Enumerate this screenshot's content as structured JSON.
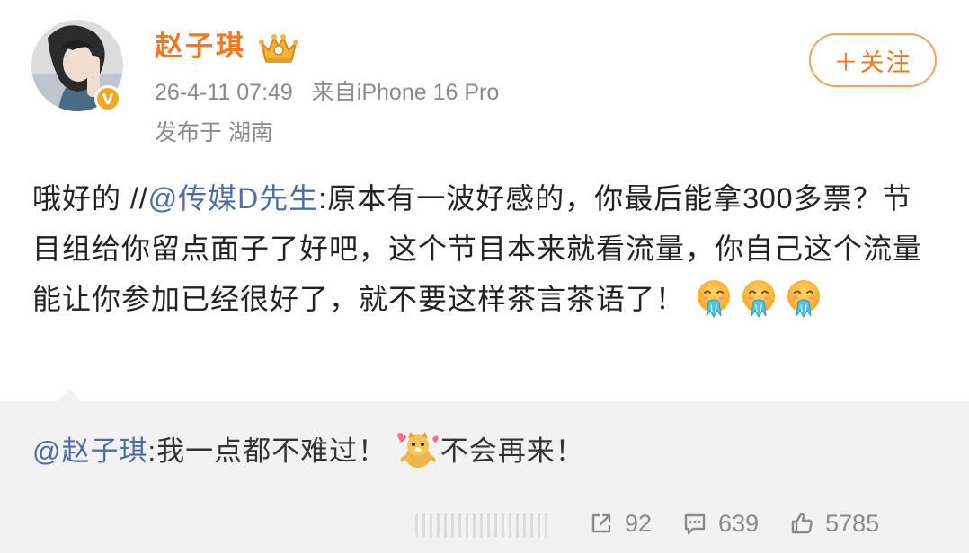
{
  "user": {
    "name": "赵子琪",
    "verified_badge": "V",
    "timestamp": "26-4-11 07:49",
    "source": "来自iPhone 16 Pro",
    "location": "发布于 湖南",
    "avatar_icon": "avatar-photo",
    "crown_icon": "crown-icon"
  },
  "follow": {
    "label": "＋关注"
  },
  "post": {
    "prefix": "哦好的 //",
    "mention": "@传媒D先生",
    "text": ":原本有一波好感的，你最后能拿300多票？节目组给你留点面子了好吧，这个节目本来就看流量，你自己这个流量能让你参加已经很好了，就不要这样茶言茶语了！",
    "emoji_icon": "vomit-emoji",
    "emoji_count": 3
  },
  "repost": {
    "mention": "@赵子琪",
    "text_before": ":我一点都不难过！",
    "emoji_icon": "hug-dog-emoji",
    "text_after": "不会再来！"
  },
  "actions": {
    "share_count": "92",
    "comment_count": "639",
    "like_count": "5785",
    "share_icon": "share-icon",
    "comment_icon": "comment-icon",
    "like_icon": "thumbs-up-icon"
  },
  "colors": {
    "accent": "#f47621",
    "link": "#506da3",
    "meta": "#8a8a8a",
    "repost_bg": "#f2f2f2"
  }
}
